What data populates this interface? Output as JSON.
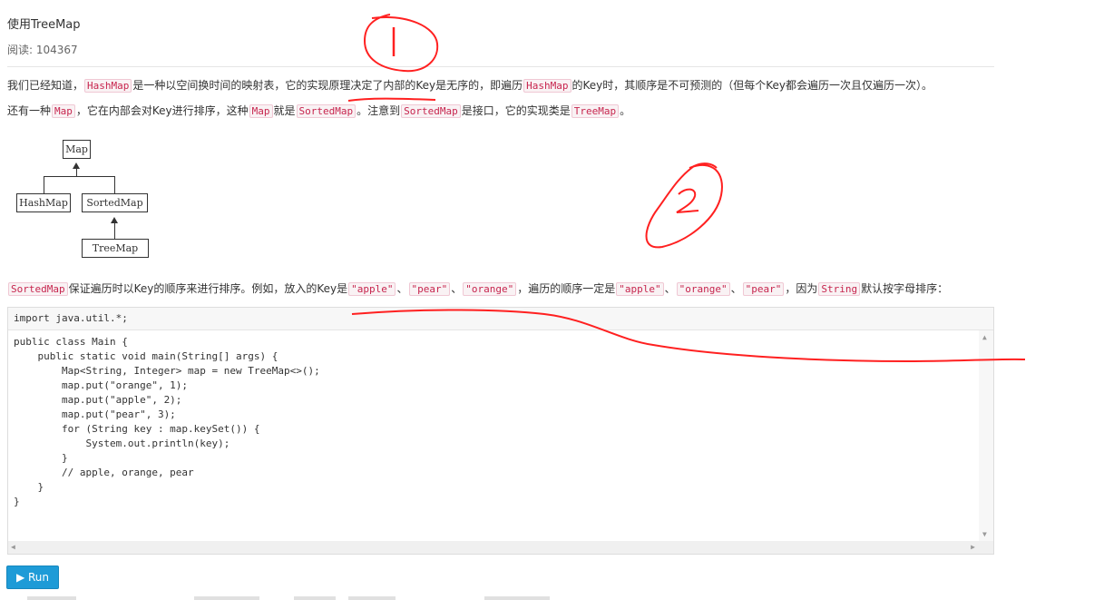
{
  "article": {
    "title": "使用TreeMap",
    "reads_label": "阅读: 104367"
  },
  "para1": {
    "t1": "我们已经知道，",
    "c1": "HashMap",
    "t2": "是一种以空间换时间的映射表，它的实现原理决定了内部的Key是无序的，即遍历",
    "c2": "HashMap",
    "t3": "的Key时，其顺序是不可预测的（但每个Key都会遍历一次且仅遍历一次）。"
  },
  "para2": {
    "t1": "还有一种",
    "c1": "Map",
    "t2": "，它在内部会对Key进行排序，这种",
    "c2": "Map",
    "t3": "就是",
    "c3": "SortedMap",
    "t4": "。注意到",
    "c4": "SortedMap",
    "t5": "是接口，它的实现类是",
    "c5": "TreeMap",
    "t6": "。"
  },
  "diagram": {
    "map": "Map",
    "hashmap": "HashMap",
    "sortedmap": "SortedMap",
    "treemap": "TreeMap"
  },
  "para3": {
    "c1": "SortedMap",
    "t1": "保证遍历时以Key的顺序来进行排序。例如，放入的Key是",
    "c2": "\"apple\"",
    "t2": "、",
    "c3": "\"pear\"",
    "t3": "、",
    "c4": "\"orange\"",
    "t4": "，遍历的顺序一定是",
    "c5": "\"apple\"",
    "t5": "、",
    "c6": "\"orange\"",
    "t6": "、",
    "c7": "\"pear\"",
    "t7": "，因为",
    "c8": "String",
    "t8": "默认按字母排序："
  },
  "editor": {
    "import_line": "import java.util.*;",
    "code_lines": [
      "public class Main {",
      "    public static void main(String[] args) {",
      "        Map<String, Integer> map = new TreeMap<>();",
      "        map.put(\"orange\", 1);",
      "        map.put(\"apple\", 2);",
      "        map.put(\"pear\", 3);",
      "        for (String key : map.keySet()) {",
      "            System.out.println(key);",
      "        }",
      "        // apple, orange, pear",
      "    }",
      "}"
    ]
  },
  "run_button": {
    "label": "▶ Run"
  },
  "annotations": {
    "color": "#ff2020",
    "circle1_label": "1",
    "circle2_label": "2"
  }
}
